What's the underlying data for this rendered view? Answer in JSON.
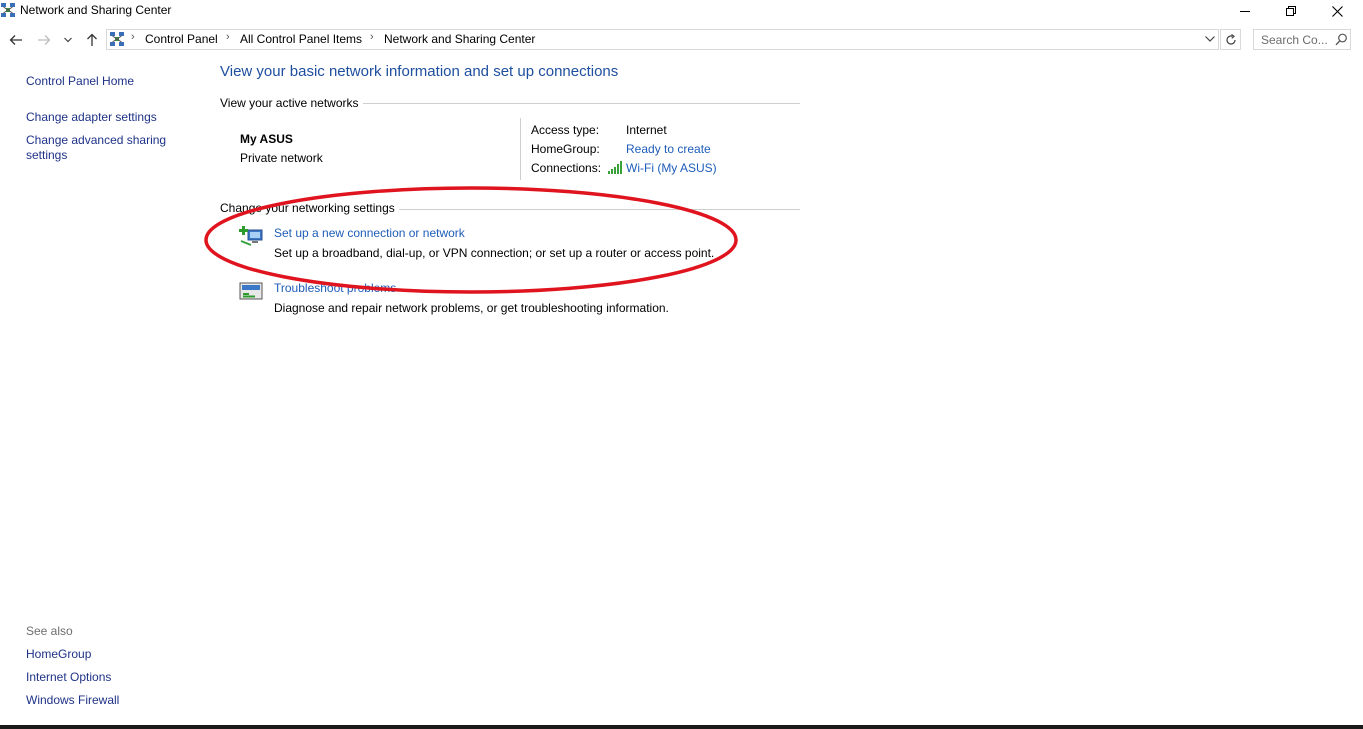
{
  "window": {
    "title": "Network and Sharing Center"
  },
  "address_bar": {
    "breadcrumbs": [
      "Control Panel",
      "All Control Panel Items",
      "Network and Sharing Center"
    ],
    "search_placeholder": "Search Co..."
  },
  "sidebar": {
    "home_label": "Control Panel Home",
    "links": [
      "Change adapter settings",
      "Change advanced sharing settings"
    ],
    "see_also_label": "See also",
    "see_also": [
      "HomeGroup",
      "Internet Options",
      "Windows Firewall"
    ]
  },
  "main": {
    "heading": "View your basic network information and set up connections",
    "active_networks_label": "View your active networks",
    "network": {
      "name": "My ASUS",
      "type": "Private network",
      "access_type_label": "Access type:",
      "access_type_value": "Internet",
      "homegroup_label": "HomeGroup:",
      "homegroup_value": "Ready to create",
      "connections_label": "Connections:",
      "connections_value": "Wi-Fi (My ASUS)"
    },
    "change_settings_label": "Change your networking settings",
    "tasks": [
      {
        "title": "Set up a new connection or network",
        "description": "Set up a broadband, dial-up, or VPN connection; or set up a router or access point.",
        "icon": "new-connection-icon"
      },
      {
        "title": "Troubleshoot problems",
        "description": "Diagnose and repair network problems, or get troubleshooting information.",
        "icon": "troubleshoot-icon"
      }
    ]
  },
  "colors": {
    "link": "#1e5db8",
    "heading": "#1e4e9f",
    "highlight_ellipse": "#e0141e"
  }
}
